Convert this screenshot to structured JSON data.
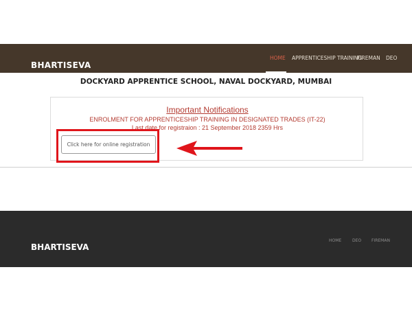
{
  "header": {
    "brand": "BHARTISEVA",
    "nav": [
      "HOME",
      "APPRENTICESHIP TRAINING",
      "FIREMAN",
      "DEO"
    ]
  },
  "page": {
    "heading": "DOCKYARD APPRENTICE SCHOOL, NAVAL DOCKYARD, MUMBAI"
  },
  "notice": {
    "title": "Important Notifications",
    "line1": "ENROLMENT FOR APPRENTICESHIP TRAINING IN DESIGNATED TRADES (IT-22)",
    "line2": "Last date for registraion : 21 September 2018 2359 Hrs",
    "button_label": "Click here for online registration"
  },
  "footer": {
    "brand": "BHARTISEVA",
    "nav": [
      "HOME",
      "DEO",
      "FIREMAN"
    ]
  },
  "colors": {
    "nav_bg": "#45372a",
    "active_nav": "#d9624a",
    "notice_text": "#b33a30",
    "highlight": "#e0151b",
    "footer_bg": "#2b2b2b"
  }
}
